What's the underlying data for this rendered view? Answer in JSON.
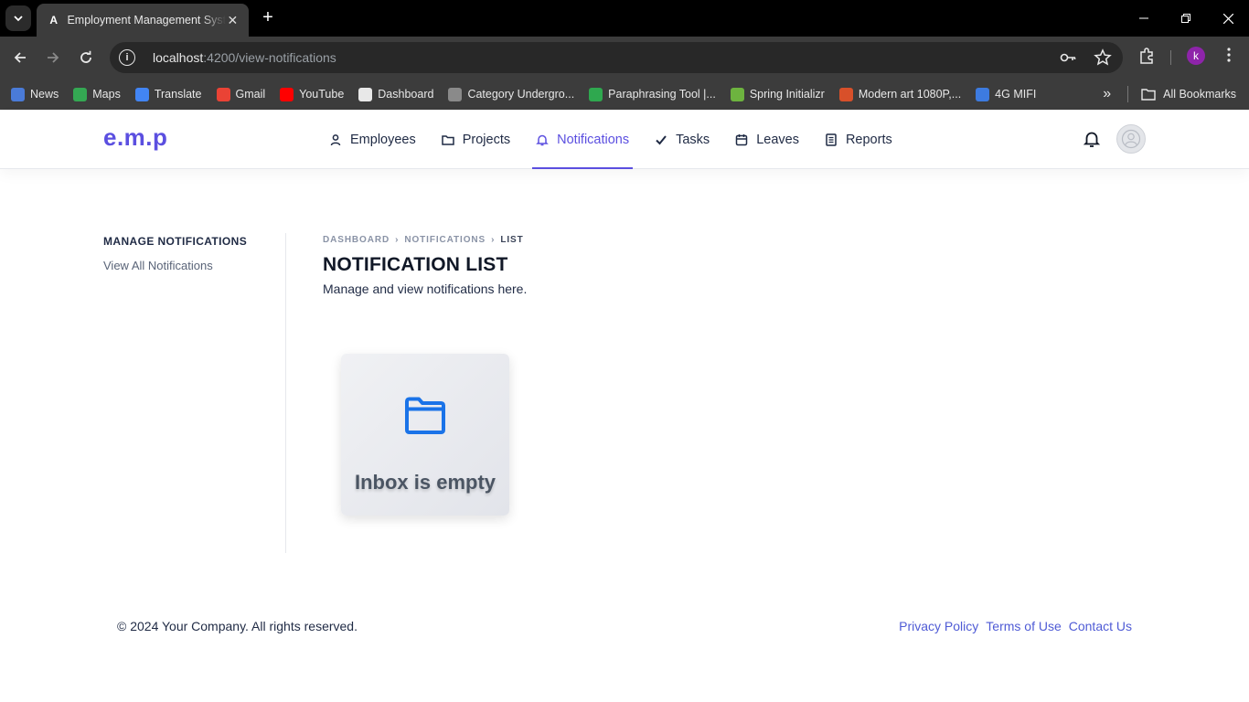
{
  "browser": {
    "tab_title": "Employment Management System",
    "tab_favicon": "A",
    "url_host": "localhost",
    "url_path": ":4200/view-notifications",
    "profile_initial": "k",
    "bookmarks": [
      {
        "label": "News",
        "color": "#4a7bd8"
      },
      {
        "label": "Maps",
        "color": "#34a853"
      },
      {
        "label": "Translate",
        "color": "#4285f4"
      },
      {
        "label": "Gmail",
        "color": "#ea4335"
      },
      {
        "label": "YouTube",
        "color": "#ff0000"
      },
      {
        "label": "Dashboard",
        "color": "#e8e8e8"
      },
      {
        "label": "Category Undergro...",
        "color": "#8a8a8a"
      },
      {
        "label": "Paraphrasing Tool |...",
        "color": "#2fa84f"
      },
      {
        "label": "Spring Initializr",
        "color": "#6db33f"
      },
      {
        "label": "Modern art 1080P,...",
        "color": "#d8502a"
      },
      {
        "label": "4G MIFI",
        "color": "#3d7be0"
      }
    ],
    "all_bookmarks": "All Bookmarks"
  },
  "header": {
    "brand": "e.m.p",
    "nav": [
      {
        "label": "Employees",
        "icon": "person-icon"
      },
      {
        "label": "Projects",
        "icon": "folder-icon"
      },
      {
        "label": "Notifications",
        "icon": "bell-icon"
      },
      {
        "label": "Tasks",
        "icon": "check-icon"
      },
      {
        "label": "Leaves",
        "icon": "calendar-icon"
      },
      {
        "label": "Reports",
        "icon": "document-icon"
      }
    ],
    "active": "Notifications",
    "accent": "#5b4fe0"
  },
  "sidebar": {
    "title": "MANAGE NOTIFICATIONS",
    "link": "View All Notifications"
  },
  "main": {
    "breadcrumb": [
      "DASHBOARD",
      "NOTIFICATIONS",
      "LIST"
    ],
    "title": "NOTIFICATION LIST",
    "subtitle": "Manage and view notifications here.",
    "empty_text": "Inbox is empty",
    "empty_icon_color": "#1a73e8"
  },
  "footer": {
    "copyright": "© 2024 Your Company. All rights reserved.",
    "links": [
      "Privacy Policy",
      "Terms of Use",
      "Contact Us"
    ]
  }
}
